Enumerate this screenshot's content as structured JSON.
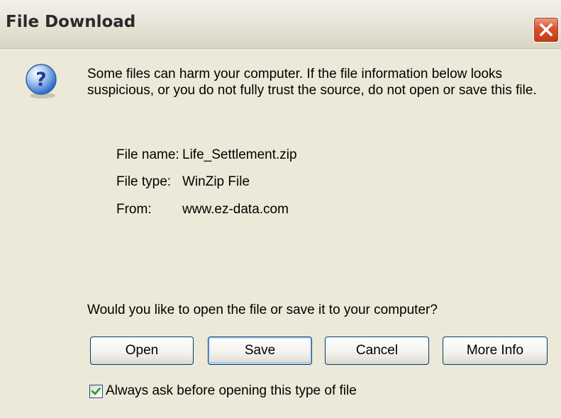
{
  "window": {
    "title": "File Download"
  },
  "dialog": {
    "warning": "Some files can harm your computer. If the file information below looks suspicious, or you do not fully trust the source, do not open or save this file.",
    "info": [
      {
        "label": "File name:",
        "value": "Life_Settlement.zip"
      },
      {
        "label": "File type:",
        "value": "WinZip File"
      },
      {
        "label": "From:",
        "value": "www.ez-data.com"
      }
    ],
    "question": "Would you like to open the file or save it to your computer?",
    "buttons": {
      "open": "Open",
      "save": "Save",
      "cancel": "Cancel",
      "more_info": "More Info"
    },
    "checkbox": {
      "label": "Always ask before opening this type of file",
      "checked": true
    }
  },
  "icons": {
    "dialog_icon": "question-icon",
    "close": "close-icon",
    "check": "checkmark-icon"
  },
  "colors": {
    "dialog_bg": "#ece9d8",
    "close_red": "#d9512c",
    "icon_blue": "#2d6ec9",
    "check_green": "#21a121",
    "button_border": "#003c74"
  }
}
